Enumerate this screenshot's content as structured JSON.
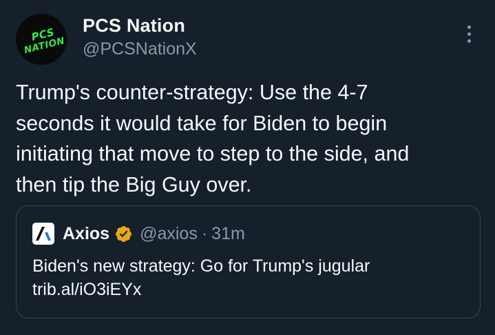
{
  "author": {
    "name": "PCS Nation",
    "handle": "@PCSNationX",
    "avatar_logo_text": "PCS NATION"
  },
  "tweet": {
    "text_lines": [
      "Trump's counter-strategy: Use the 4-7",
      "seconds it would take for Biden to begin",
      "initiating that move to step to the side, and",
      "then tip the Big Guy over."
    ]
  },
  "quoted_tweet": {
    "author_name": "Axios",
    "author_handle": "@axios",
    "separator": "·",
    "time_ago": "31m",
    "verified": true,
    "text_lines": [
      "Biden's new strategy: Go for Trump's jugular",
      "trib.al/iO3iEYx"
    ]
  },
  "icons": {
    "more": "more-vertical-icon",
    "verified": "verified-badge-icon",
    "quote_logo": "axios-logo-icon"
  },
  "colors": {
    "background": "#15202b",
    "text_primary": "#f7f9f9",
    "text_secondary": "#8b98a5",
    "border": "#38444d",
    "avatar_accent": "#2ee94a",
    "verified_gold": "#e8a915"
  }
}
